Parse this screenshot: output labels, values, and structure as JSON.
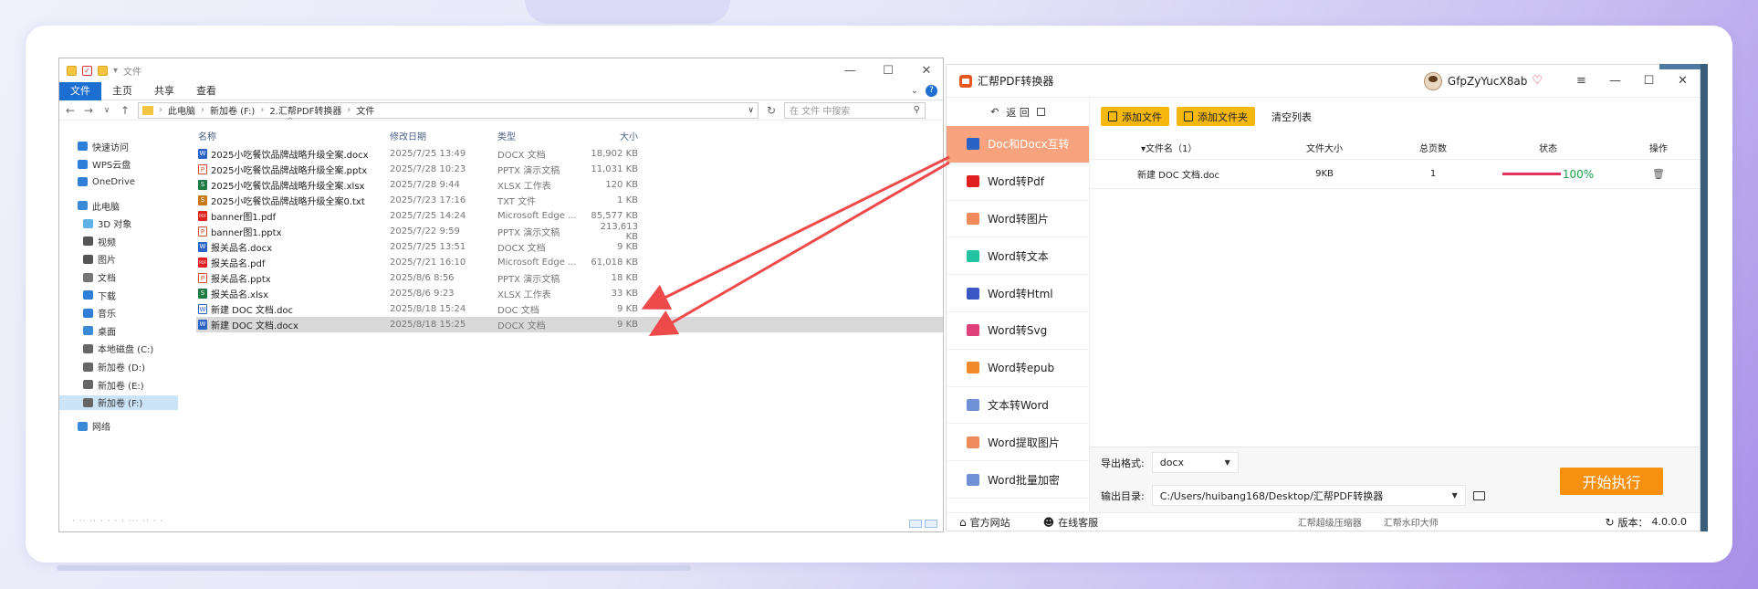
{
  "explorer": {
    "title": "文件",
    "ribbon_tabs": [
      "文件",
      "主页",
      "共享",
      "查看"
    ],
    "help_icon": "?",
    "address": {
      "segments": [
        "此电脑",
        "新加卷 (F:)",
        "2.汇帮PDF转换器",
        "文件"
      ],
      "search_placeholder": "在 文件 中搜索"
    },
    "sidebar": [
      {
        "label": "快速访问",
        "icon": "star-icon",
        "color": "#2f7ed8"
      },
      {
        "label": "WPS云盘",
        "icon": "cloud-icon",
        "color": "#2f7ed8"
      },
      {
        "label": "OneDrive",
        "icon": "onedrive-icon",
        "color": "#2f7ed8"
      },
      {
        "label": "此电脑",
        "icon": "computer-icon",
        "color": "#3a8ad6"
      },
      {
        "label": "3D 对象",
        "icon": "cube-icon",
        "color": "#5fb2e8"
      },
      {
        "label": "视频",
        "icon": "video-icon",
        "color": "#555"
      },
      {
        "label": "图片",
        "icon": "picture-icon",
        "color": "#555"
      },
      {
        "label": "文档",
        "icon": "document-icon",
        "color": "#777"
      },
      {
        "label": "下载",
        "icon": "download-icon",
        "color": "#2f7ed8"
      },
      {
        "label": "音乐",
        "icon": "music-icon",
        "color": "#2f7ed8"
      },
      {
        "label": "桌面",
        "icon": "desktop-icon",
        "color": "#3a8ad6"
      },
      {
        "label": "本地磁盘 (C:)",
        "icon": "drive-icon",
        "color": "#666"
      },
      {
        "label": "新加卷 (D:)",
        "icon": "drive-icon",
        "color": "#666"
      },
      {
        "label": "新加卷 (E:)",
        "icon": "drive-icon",
        "color": "#666"
      },
      {
        "label": "新加卷 (F:)",
        "icon": "drive-icon",
        "color": "#666"
      },
      {
        "label": "网络",
        "icon": "network-icon",
        "color": "#3a8ad6"
      }
    ],
    "columns": [
      "名称",
      "修改日期",
      "类型",
      "大小"
    ],
    "files": [
      {
        "name": "2025小吃餐饮品牌战略升级全案.docx",
        "date": "2025/7/25 13:49",
        "type": "DOCX 文档",
        "size": "18,902 KB",
        "kind": "docx",
        "glyph": "W"
      },
      {
        "name": "2025小吃餐饮品牌战略升级全案.pptx",
        "date": "2025/7/28 10:23",
        "type": "PPTX 演示文稿",
        "size": "11,031 KB",
        "kind": "pptx",
        "glyph": "P"
      },
      {
        "name": "2025小吃餐饮品牌战略升级全案.xlsx",
        "date": "2025/7/28 9:44",
        "type": "XLSX 工作表",
        "size": "120 KB",
        "kind": "xlsx",
        "glyph": "S"
      },
      {
        "name": "2025小吃餐饮品牌战略升级全案0.txt",
        "date": "2025/7/23 17:16",
        "type": "TXT 文件",
        "size": "1 KB",
        "kind": "txt",
        "glyph": "S"
      },
      {
        "name": "banner图1.pdf",
        "date": "2025/7/25 14:24",
        "type": "Microsoft Edge ...",
        "size": "85,577 KB",
        "kind": "pdf",
        "glyph": "PDF"
      },
      {
        "name": "banner图1.pptx",
        "date": "2025/7/22 9:59",
        "type": "PPTX 演示文稿",
        "size": "213,613 KB",
        "kind": "pptx",
        "glyph": "P"
      },
      {
        "name": "报关品名.docx",
        "date": "2025/7/25 13:51",
        "type": "DOCX 文档",
        "size": "9 KB",
        "kind": "docx",
        "glyph": "W"
      },
      {
        "name": "报关品名.pdf",
        "date": "2025/7/21 16:10",
        "type": "Microsoft Edge ...",
        "size": "61,018 KB",
        "kind": "pdf",
        "glyph": "PDF"
      },
      {
        "name": "报关品名.pptx",
        "date": "2025/8/6 8:56",
        "type": "PPTX 演示文稿",
        "size": "18 KB",
        "kind": "pptx",
        "glyph": "P"
      },
      {
        "name": "报关品名.xlsx",
        "date": "2025/8/6 9:23",
        "type": "XLSX 工作表",
        "size": "33 KB",
        "kind": "xlsx",
        "glyph": "S"
      },
      {
        "name": "新建 DOC 文档.doc",
        "date": "2025/8/18 15:24",
        "type": "DOC 文档",
        "size": "9 KB",
        "kind": "doc",
        "glyph": "W"
      },
      {
        "name": "新建 DOC 文档.docx",
        "date": "2025/8/18 15:25",
        "type": "DOCX 文档",
        "size": "9 KB",
        "kind": "docx",
        "glyph": "W",
        "selected": true
      }
    ]
  },
  "converter": {
    "app_name": "汇帮PDF转换器",
    "username": "GfpZyYucX8ab",
    "back_label": "返 回",
    "nav": [
      {
        "label": "Doc和Docx互转",
        "icon": "word-icon",
        "color": "#2b62c6",
        "active": true
      },
      {
        "label": "Word转Pdf",
        "icon": "pdf-icon",
        "color": "#e02020"
      },
      {
        "label": "Word转图片",
        "icon": "image-icon",
        "color": "#f08a5a"
      },
      {
        "label": "Word转文本",
        "icon": "text-icon",
        "color": "#23c4a2"
      },
      {
        "label": "Word转Html",
        "icon": "html-icon",
        "color": "#3b57c4"
      },
      {
        "label": "Word转Svg",
        "icon": "svg-icon",
        "color": "#e0407a"
      },
      {
        "label": "Word转epub",
        "icon": "epub-icon",
        "color": "#f08a2a"
      },
      {
        "label": "文本转Word",
        "icon": "word-outline-icon",
        "color": "#6f8fd6"
      },
      {
        "label": "Word提取图片",
        "icon": "extract-image-icon",
        "color": "#f08a5a"
      },
      {
        "label": "Word批量加密",
        "icon": "lock-word-icon",
        "color": "#6f8fd6"
      }
    ],
    "toolbar": {
      "add_file": "添加文件",
      "add_folder": "添加文件夹",
      "clear_list": "清空列表"
    },
    "table": {
      "headers": [
        "文件名（1）",
        "文件大小",
        "总页数",
        "状态",
        "操作"
      ],
      "rows": [
        {
          "name": "新建 DOC 文档.doc",
          "size": "9KB",
          "pages": "1",
          "progress": 100,
          "progress_label": "100%"
        }
      ]
    },
    "export_format_label": "导出格式:",
    "export_format": "docx",
    "output_dir_label": "输出目录:",
    "output_dir": "C:/Users/huibang168/Desktop/汇帮PDF转换器",
    "start_label": "开始执行",
    "footer": {
      "website": "官方网站",
      "support": "在线客服",
      "link1": "汇帮超级压缩器",
      "link2": "汇帮水印大师",
      "version_label": "版本：",
      "version": "4.0.0.0"
    },
    "accent": "#f8a37e",
    "button_yellow": "#f7b80e",
    "button_orange": "#f7900f"
  }
}
